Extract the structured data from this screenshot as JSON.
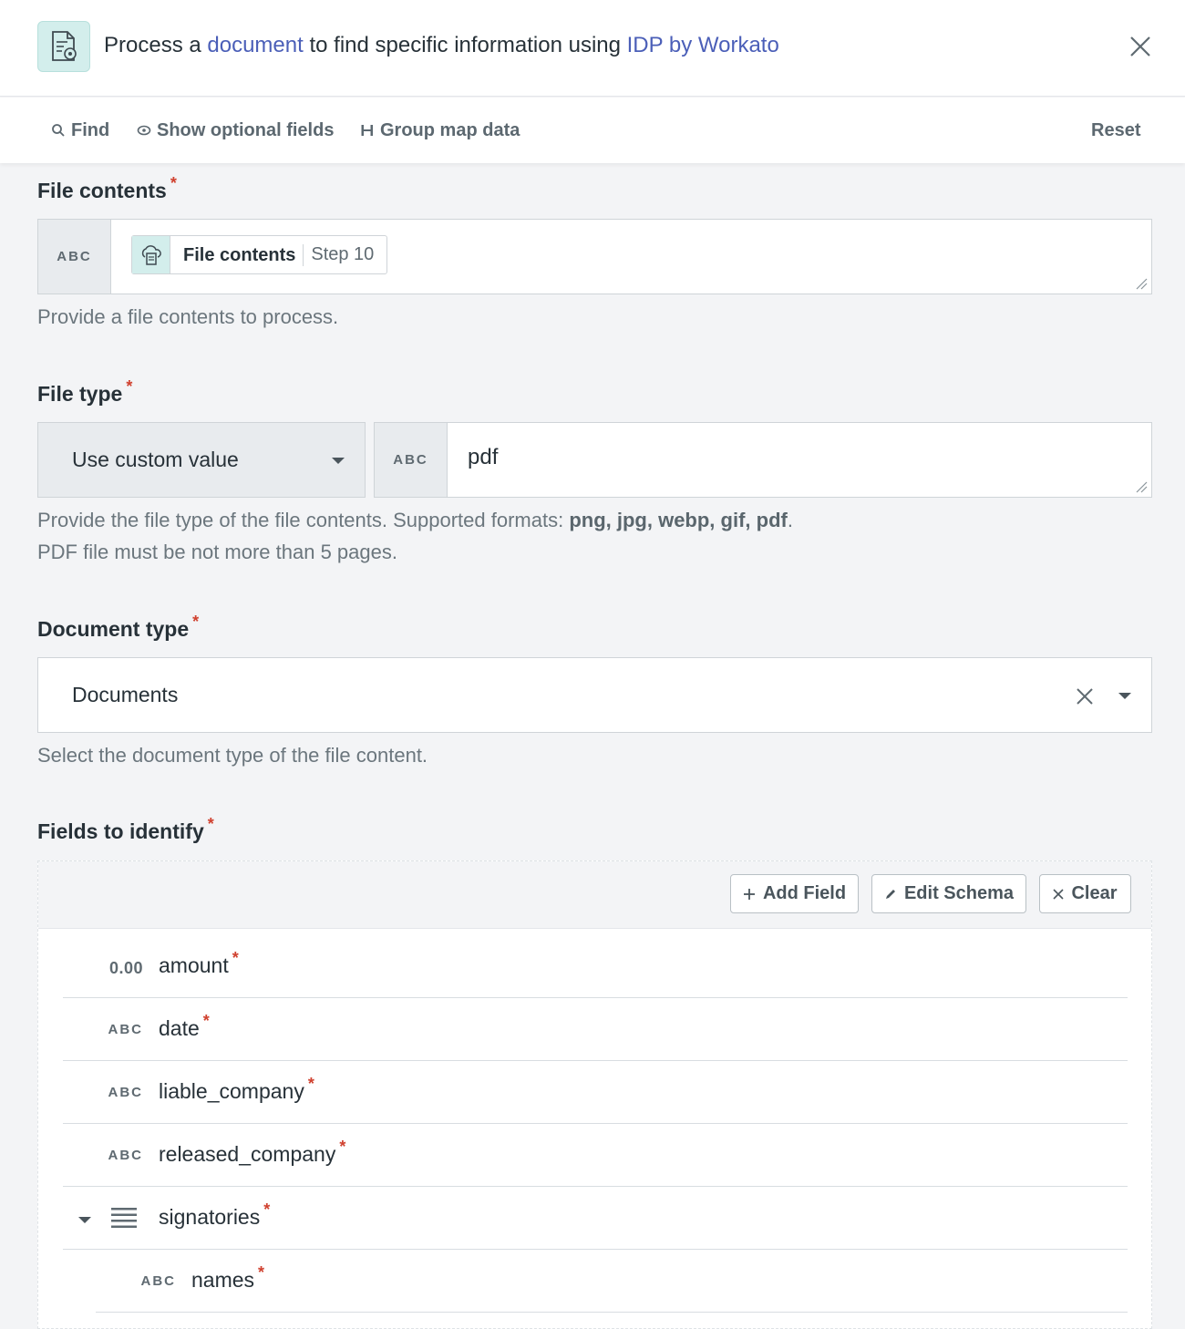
{
  "header": {
    "title_prefix": "Process a ",
    "title_link1": "document",
    "title_mid": " to find specific information using ",
    "title_link2": "IDP by Workato",
    "app_icon": "document-ai-icon",
    "close_icon": "close-icon"
  },
  "toolbar": {
    "find": "Find",
    "show_optional": "Show optional fields",
    "group_map": "Group map data",
    "reset": "Reset"
  },
  "file_contents": {
    "label": "File contents",
    "required": "*",
    "type": "ABC",
    "pill_name": "File contents",
    "pill_step": "Step 10",
    "help": "Provide a file contents to process."
  },
  "file_type": {
    "label": "File type",
    "required": "*",
    "select_value": "Use custom value",
    "type": "ABC",
    "value": "pdf",
    "help_prefix": "Provide the file type of the file contents. Supported formats: ",
    "help_formats": "png, jpg, webp, gif, pdf",
    "help_suffix": ".",
    "help_line2": "PDF file must be not more than 5 pages."
  },
  "document_type": {
    "label": "Document type",
    "required": "*",
    "value": "Documents",
    "help": "Select the document type of the file content."
  },
  "fields_to_identify": {
    "label": "Fields to identify",
    "required": "*",
    "buttons": {
      "add": "Add Field",
      "edit": "Edit Schema",
      "clear": "Clear"
    },
    "rows": [
      {
        "type": "0.00",
        "name": "amount",
        "req": "*"
      },
      {
        "type": "ABC",
        "name": "date",
        "req": "*"
      },
      {
        "type": "ABC",
        "name": "liable_company",
        "req": "*"
      },
      {
        "type": "ABC",
        "name": "released_company",
        "req": "*"
      },
      {
        "type": "list",
        "name": "signatories",
        "req": "*"
      },
      {
        "type": "ABC",
        "name": "names",
        "req": "*"
      }
    ]
  },
  "colors": {
    "link": "#4b5fb8",
    "required": "#d0412f",
    "accent_bg": "#d3eeec"
  }
}
